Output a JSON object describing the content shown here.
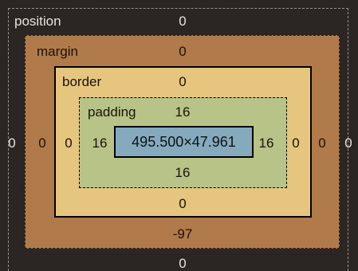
{
  "position": {
    "label": "position",
    "top": "0",
    "right": "0",
    "bottom": "0",
    "left": "0"
  },
  "margin": {
    "label": "margin",
    "top": "0",
    "right": "0",
    "bottom": "-97",
    "left": "0"
  },
  "border": {
    "label": "border",
    "top": "0",
    "right": "0",
    "bottom": "0",
    "left": "0"
  },
  "padding": {
    "label": "padding",
    "top": "16",
    "right": "16",
    "bottom": "16",
    "left": "16"
  },
  "content": {
    "size": "495.500×47.961"
  },
  "colors": {
    "background": "#2b2523",
    "margin": "#b07a4a",
    "border": "#e6c67e",
    "padding": "#b8c387",
    "content": "#85aabd"
  }
}
